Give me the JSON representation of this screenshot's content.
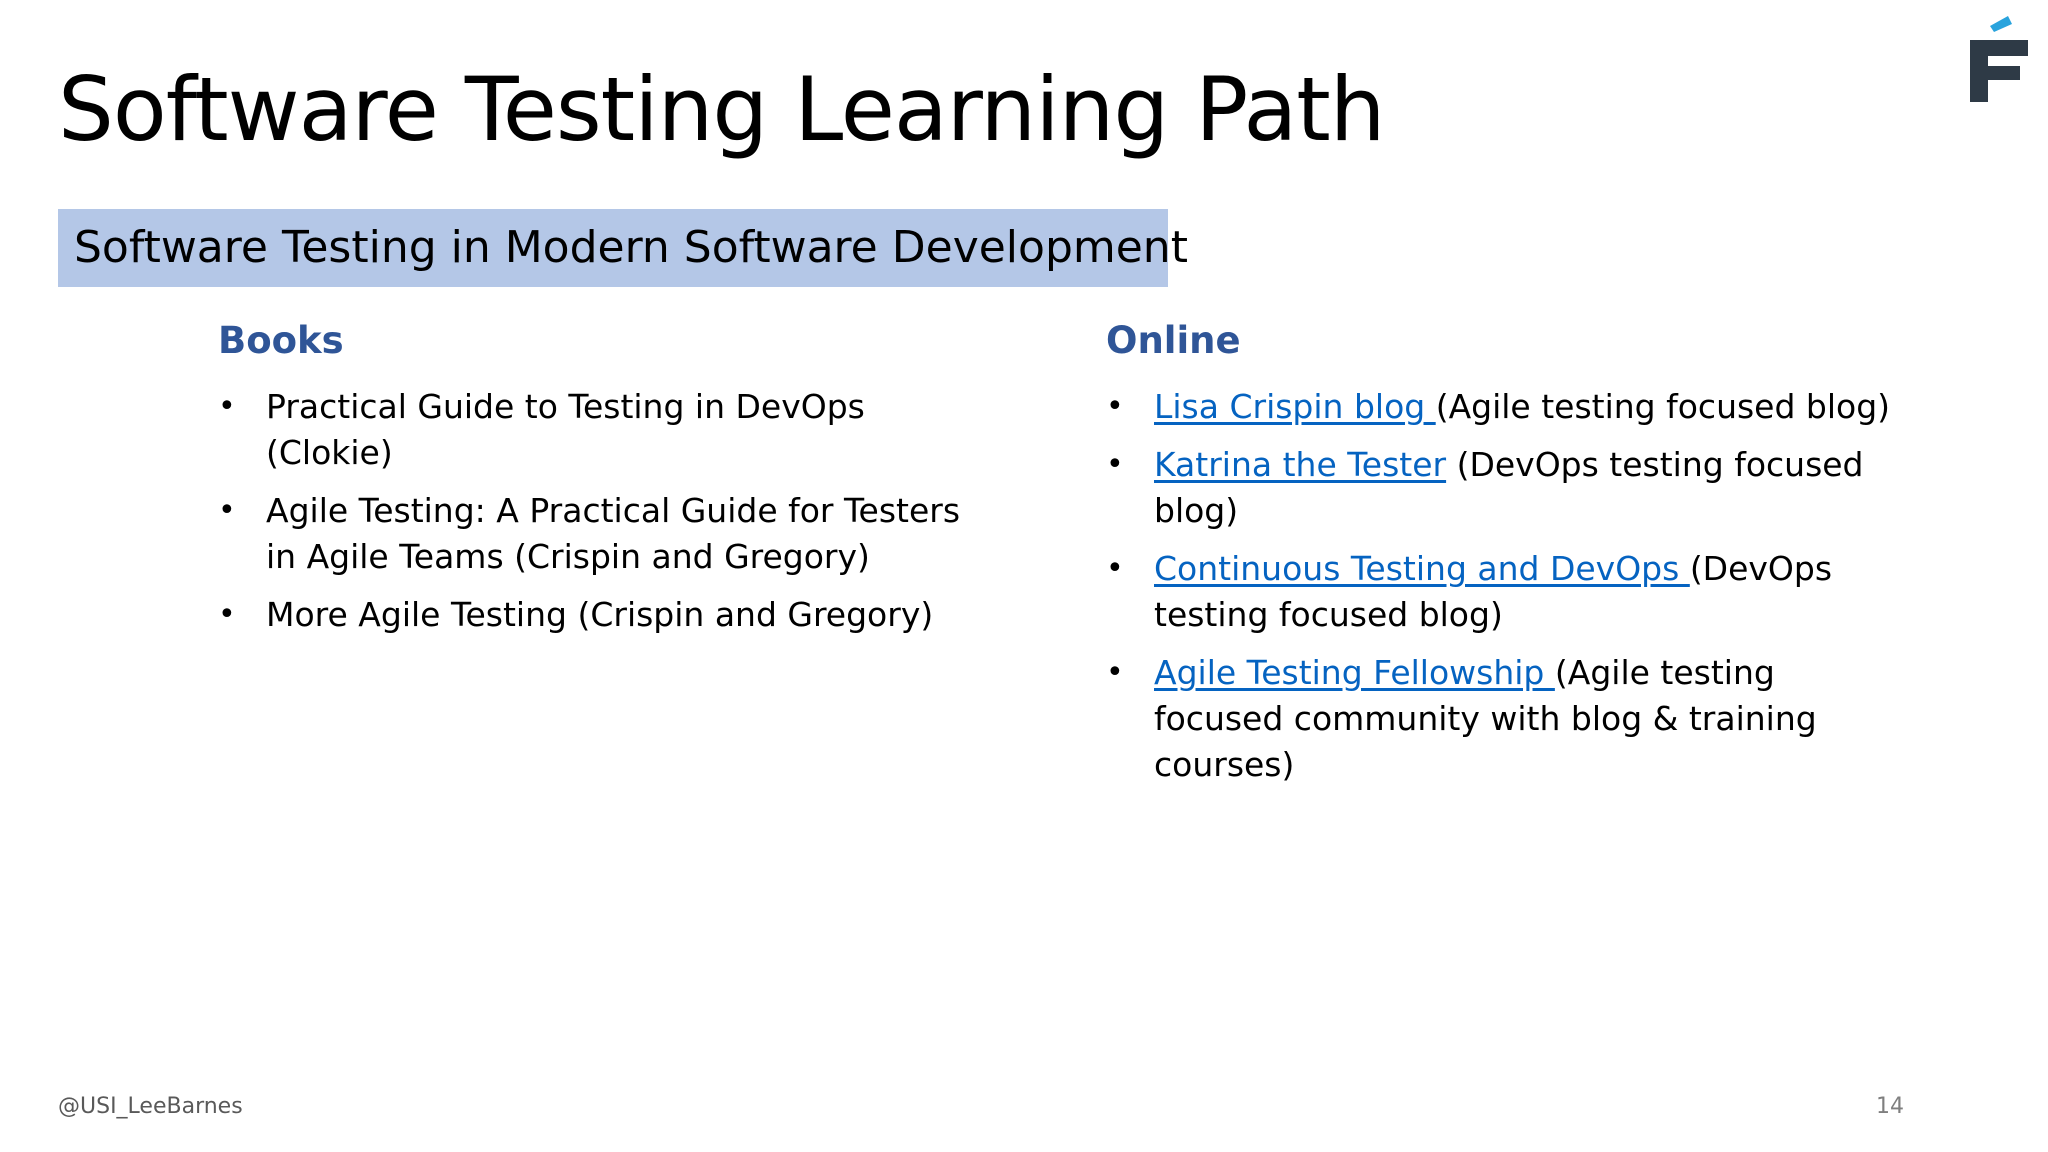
{
  "slide": {
    "title": "Software Testing Learning Path",
    "section": "Software Testing in Modern Software Development"
  },
  "brand": {
    "logo_icon": "f-logo-icon",
    "logo_dark_color": "#2e3a46",
    "logo_accent_color": "#29a3dd"
  },
  "books": {
    "heading": "Books",
    "items": [
      {
        "text": "Practical Guide to Testing in DevOps (Clokie)"
      },
      {
        "text": "Agile Testing: A Practical Guide for Testers in Agile Teams (Crispin and Gregory)"
      },
      {
        "text": "More Agile Testing (Crispin and Gregory)"
      }
    ]
  },
  "online": {
    "heading": "Online",
    "items": [
      {
        "link": "Lisa Crispin blog ",
        "text": "(Agile testing focused blog)"
      },
      {
        "link": "Katrina the Tester",
        "text": " (DevOps testing focused blog)"
      },
      {
        "link": "Continuous Testing and DevOps ",
        "text": "(DevOps testing focused blog)"
      },
      {
        "link": "Agile Testing Fellowship ",
        "text": "(Agile testing focused community with blog & training courses)"
      }
    ]
  },
  "footer": {
    "handle": "@USI_LeeBarnes",
    "page_number": "14"
  },
  "colors": {
    "banner_background": "#b4c7e7",
    "heading_color": "#2f5597",
    "link_color": "#0563c1"
  }
}
